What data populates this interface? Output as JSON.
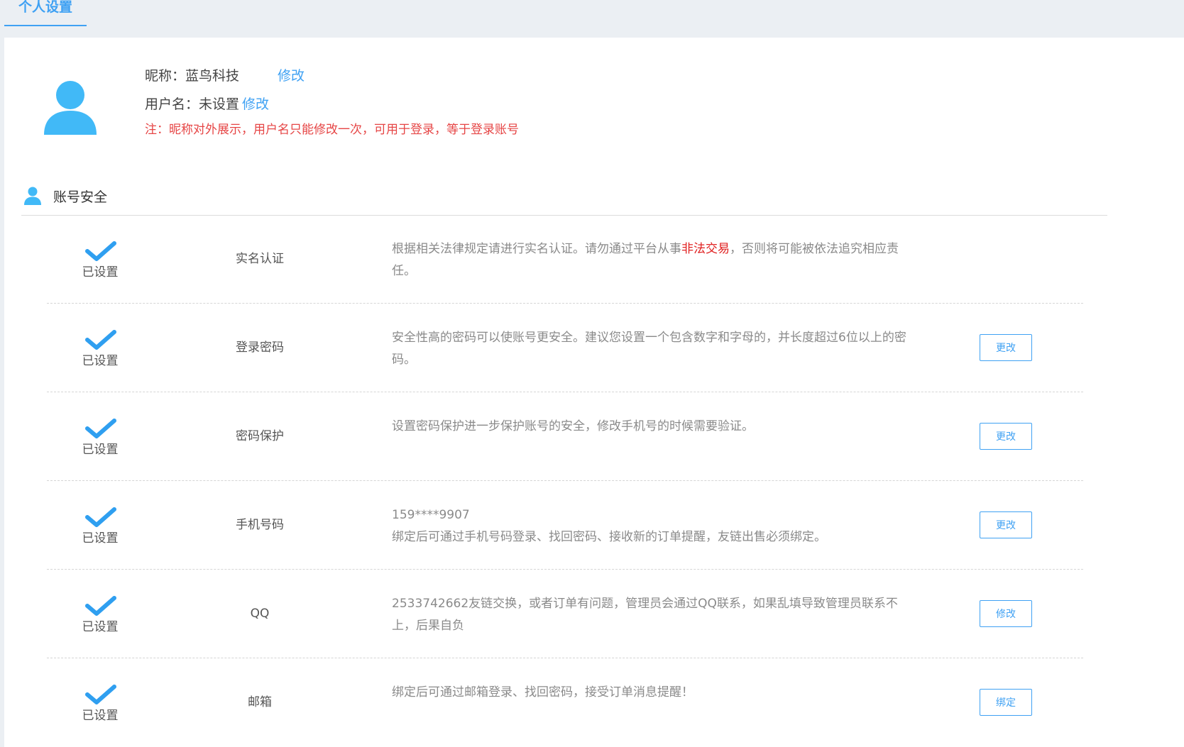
{
  "tab": {
    "label": "个人设置"
  },
  "profile": {
    "nickname_label": "昵称：",
    "nickname_value": "蓝鸟科技",
    "nickname_edit": "修改",
    "username_label": "用户名：",
    "username_value": "未设置",
    "username_edit": "修改",
    "note": "注：昵称对外展示，用户名只能修改一次，可用于登录，等于登录账号"
  },
  "security": {
    "title": "账号安全",
    "rows": [
      {
        "status": "已设置",
        "title": "实名认证",
        "desc_a": "根据相关法律规定请进行实名认证。请勿通过平台从事",
        "desc_warn": "非法交易",
        "desc_b": "，否则将可能被依法追究相应责任。"
      },
      {
        "status": "已设置",
        "title": "登录密码",
        "desc": "安全性高的密码可以使账号更安全。建议您设置一个包含数字和字母的，并长度超过6位以上的密码。",
        "button": "更改"
      },
      {
        "status": "已设置",
        "title": "密码保护",
        "desc": "设置密码保护进一步保护账号的安全，修改手机号的时候需要验证。",
        "button": "更改"
      },
      {
        "status": "已设置",
        "title": "手机号码",
        "desc_line1": "159****9907",
        "desc_line2": "绑定后可通过手机号码登录、找回密码、接收新的订单提醒，友链出售必须绑定。",
        "button": "更改"
      },
      {
        "status": "已设置",
        "title": "QQ",
        "desc": "2533742662友链交换，或者订单有问题，管理员会通过QQ联系，如果乱填导致管理员联系不上，后果自负",
        "button": "修改"
      },
      {
        "status": "已设置",
        "title": "邮箱",
        "desc": "绑定后可通过邮箱登录、找回密码，接受订单消息提醒！",
        "button": "绑定"
      }
    ]
  },
  "colors": {
    "accent": "#3fa1f3",
    "warning": "#e64545",
    "page_bg": "#ebeff3"
  }
}
